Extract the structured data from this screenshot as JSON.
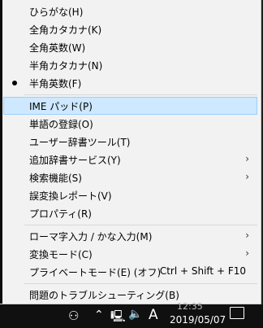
{
  "menu": {
    "items": [
      {
        "label": "ひらがな(H)"
      },
      {
        "label": "全角カタカナ(K)"
      },
      {
        "label": "全角英数(W)"
      },
      {
        "label": "半角カタカナ(N)"
      },
      {
        "label": "半角英数(F)"
      },
      {
        "label": "IME パッド(P)"
      },
      {
        "label": "単語の登録(O)"
      },
      {
        "label": "ユーザー辞書ツール(T)"
      },
      {
        "label": "追加辞書サービス(Y)"
      },
      {
        "label": "検索機能(S)"
      },
      {
        "label": "誤変換レポート(V)"
      },
      {
        "label": "プロパティ(R)"
      },
      {
        "label": "ローマ字入力 / かな入力(M)"
      },
      {
        "label": "変換モード(C)"
      },
      {
        "label": "プライベートモード(E) (オフ)",
        "shortcut": "Ctrl + Shift + F10"
      },
      {
        "label": "問題のトラブルシューティング(B)"
      }
    ]
  },
  "taskbar": {
    "time_partial": "12:35",
    "date": "2019/05/07",
    "ime_mode": "A"
  }
}
